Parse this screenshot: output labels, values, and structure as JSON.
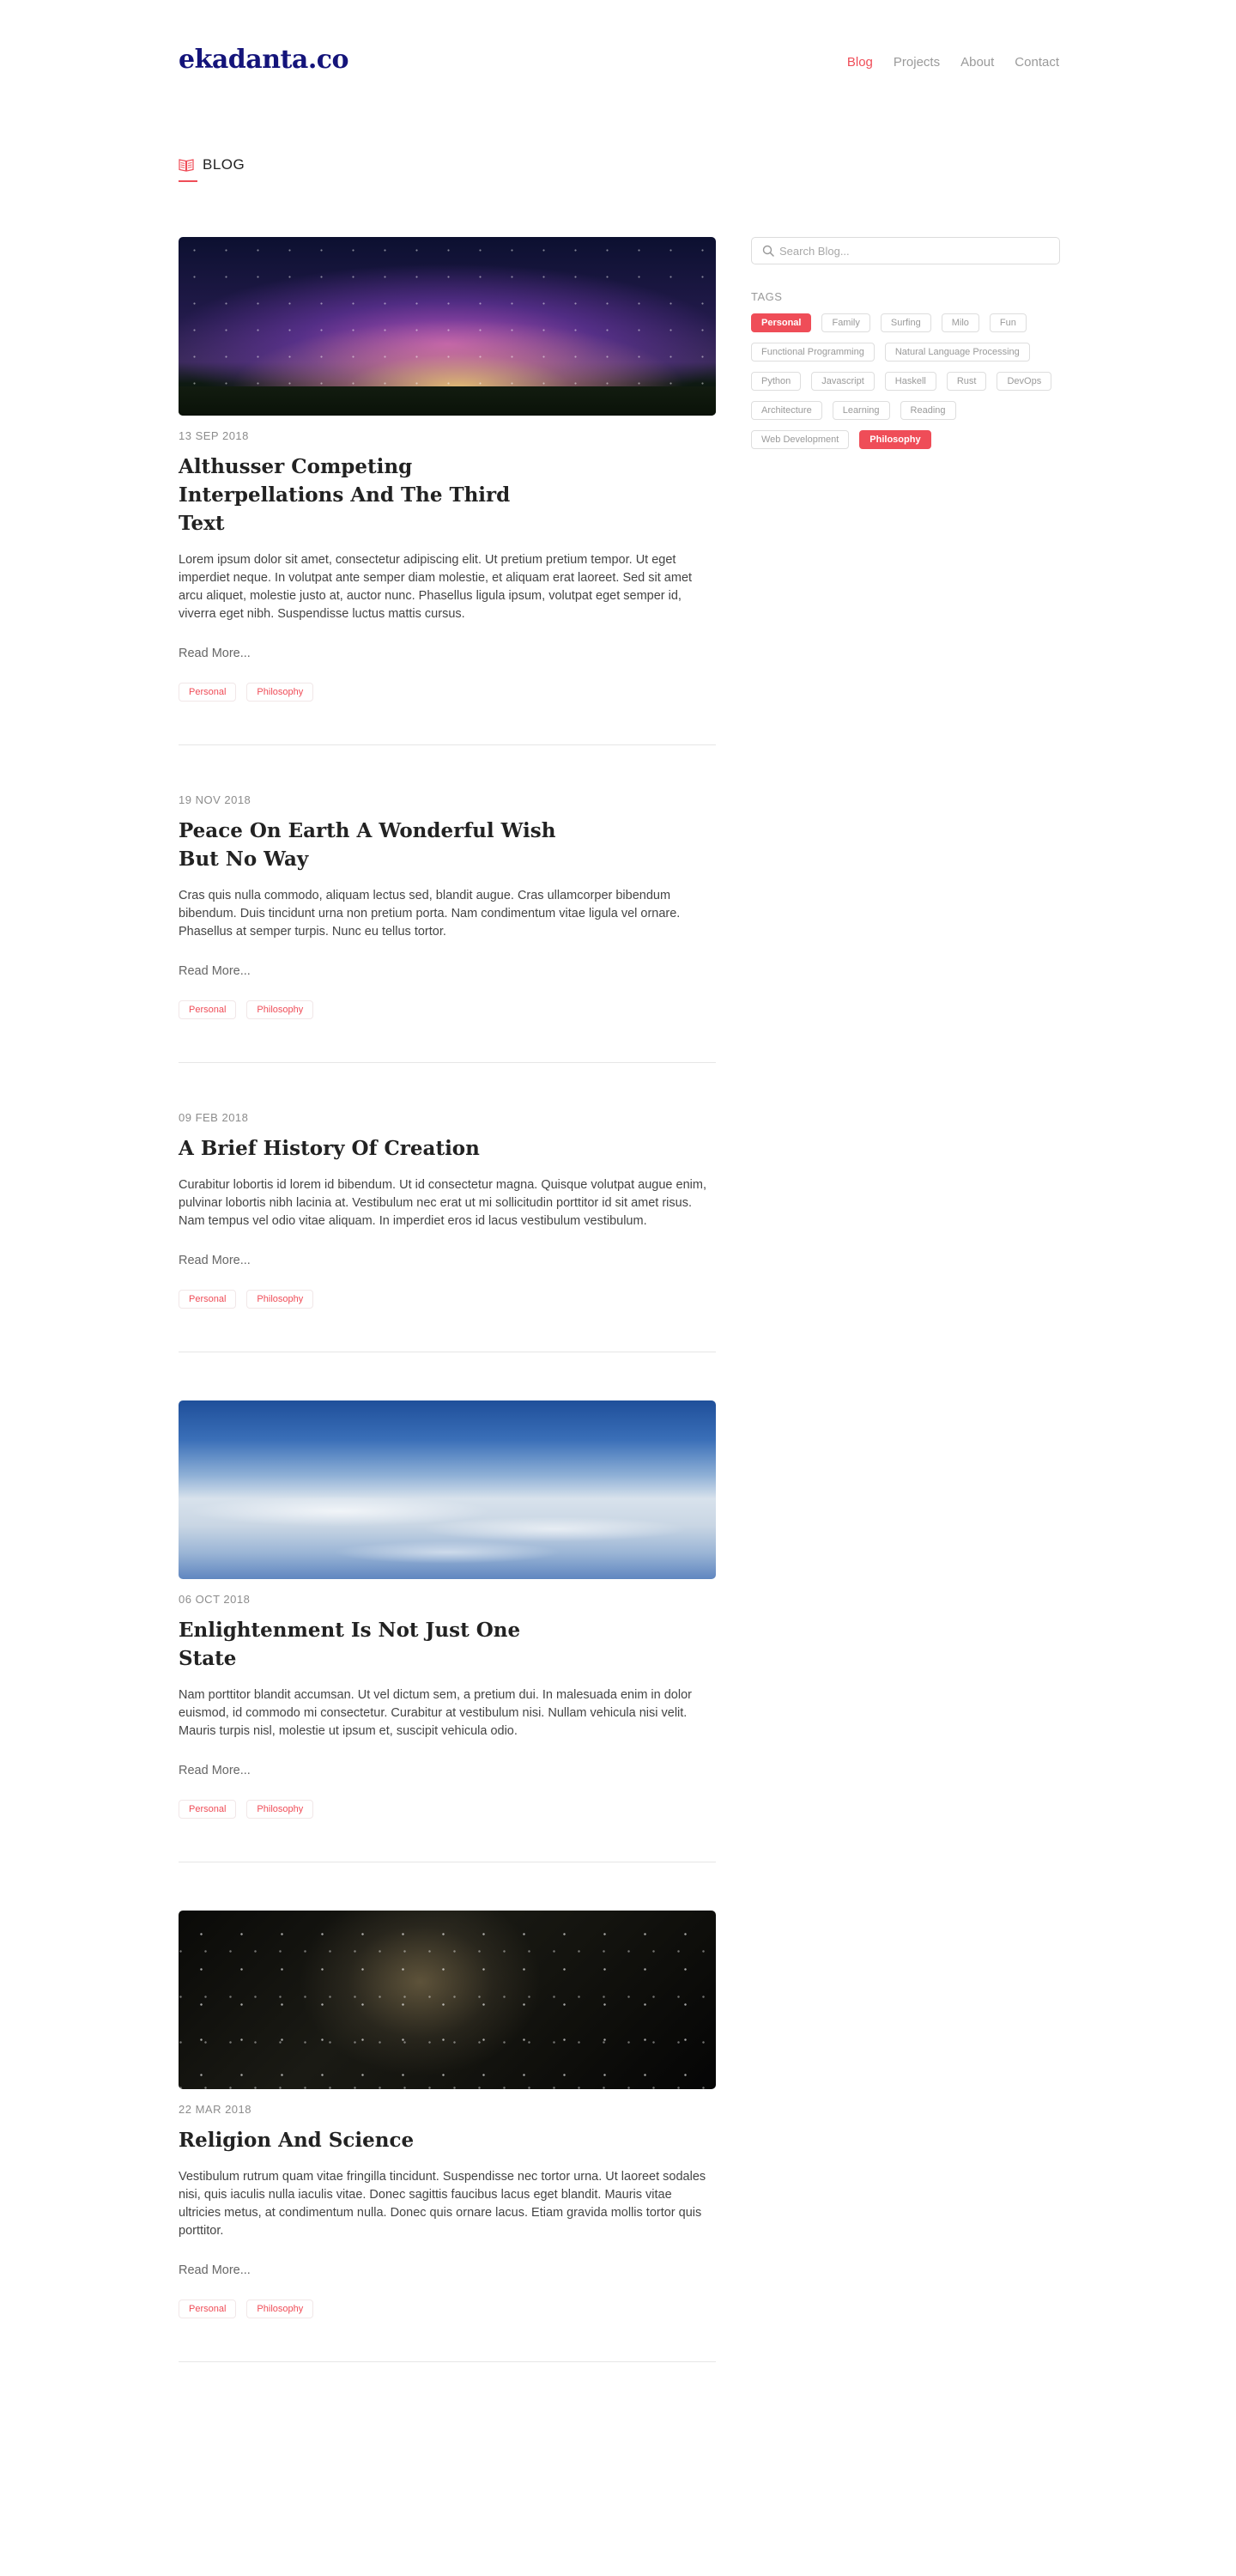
{
  "site": {
    "logo": "ekadanta",
    "logo_suffix": ".co"
  },
  "nav": {
    "items": [
      "Blog",
      "Projects",
      "About",
      "Contact"
    ]
  },
  "section": {
    "title": "BLOG"
  },
  "search": {
    "placeholder": "Search Blog..."
  },
  "sidebar": {
    "tags_heading": "TAGS",
    "tags": [
      "Personal",
      "Family",
      "Surfing",
      "Milo",
      "Fun",
      "Functional Programming",
      "Natural Language Processing",
      "Python",
      "Javascript",
      "Haskell",
      "Rust",
      "DevOps",
      "Architecture",
      "Learning",
      "Reading",
      "Web Development",
      "Philosophy"
    ],
    "active_tags": [
      "Personal",
      "Philosophy"
    ]
  },
  "posts": [
    {
      "date": "13 SEP 2018",
      "title": "Althusser Competing Interpellations And The Third Text",
      "excerpt": "Lorem ipsum dolor sit amet, consectetur adipiscing elit. Ut pretium pretium tempor. Ut eget imperdiet neque. In volutpat ante semper diam molestie, et aliquam erat laoreet. Sed sit amet arcu aliquet, molestie justo at, auctor nunc. Phasellus ligula ipsum, volutpat eget semper id, viverra eget nibh. Suspendisse luctus mattis cursus.",
      "read_more": "Read More...",
      "tags": [
        "Personal",
        "Philosophy"
      ],
      "image": "aurora"
    },
    {
      "date": "19 NOV 2018",
      "title": "Peace On Earth A Wonderful Wish But No Way",
      "excerpt": "Cras quis nulla commodo, aliquam lectus sed, blandit augue. Cras ullamcorper bibendum bibendum. Duis tincidunt urna non pretium porta. Nam condimentum vitae ligula vel ornare. Phasellus at semper turpis. Nunc eu tellus tortor.",
      "read_more": "Read More...",
      "tags": [
        "Personal",
        "Philosophy"
      ],
      "image": ""
    },
    {
      "date": "09 FEB 2018",
      "title": "A Brief History Of Creation",
      "excerpt": "Curabitur lobortis id lorem id bibendum. Ut id consectetur magna. Quisque volutpat augue enim, pulvinar lobortis nibh lacinia at. Vestibulum nec erat ut mi sollicitudin porttitor id sit amet risus. Nam tempus vel odio vitae aliquam. In imperdiet eros id lacus vestibulum vestibulum.",
      "read_more": "Read More...",
      "tags": [
        "Personal",
        "Philosophy"
      ],
      "image": ""
    },
    {
      "date": "06 OCT 2018",
      "title": "Enlightenment Is Not Just One State",
      "excerpt": "Nam porttitor blandit accumsan. Ut vel dictum sem, a pretium dui. In malesuada enim in dolor euismod, id commodo mi consectetur. Curabitur at vestibulum nisi. Nullam vehicula nisi velit. Mauris turpis nisl, molestie ut ipsum et, suscipit vehicula odio.",
      "read_more": "Read More...",
      "tags": [
        "Personal",
        "Philosophy"
      ],
      "image": "earth"
    },
    {
      "date": "22 MAR 2018",
      "title": "Religion And Science",
      "excerpt": "Vestibulum rutrum quam vitae fringilla tincidunt. Suspendisse nec tortor urna. Ut laoreet sodales nisi, quis iaculis nulla iaculis vitae. Donec sagittis faucibus lacus eget blandit. Mauris vitae ultricies metus, at condimentum nulla. Donec quis ornare lacus. Etiam gravida mollis tortor quis porttitor.",
      "read_more": "Read More...",
      "tags": [
        "Personal",
        "Philosophy"
      ],
      "image": "galaxy"
    }
  ],
  "colors": {
    "accent": "#ef4d58",
    "logo": "#14147a",
    "text": "#333333",
    "muted": "#9a9a9a"
  }
}
